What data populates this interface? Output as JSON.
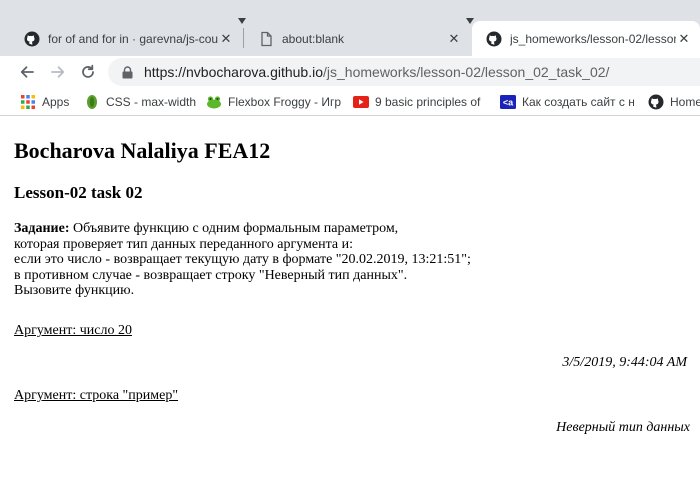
{
  "browser": {
    "tabs": [
      {
        "title": "for of and for in · garevna/js-cou",
        "icon": "github-icon",
        "active": false
      },
      {
        "title": "about:blank",
        "icon": "page-icon",
        "active": false
      },
      {
        "title": "js_homeworks/lesson-02/lesson_",
        "icon": "github-icon",
        "active": true
      }
    ],
    "close_glyph": "✕",
    "url_host": "https://nvbocharova.github.io",
    "url_path": "/js_homeworks/lesson-02/lesson_02_task_02/",
    "bookmarks": [
      {
        "label": "Apps",
        "icon": "apps-grid-icon"
      },
      {
        "label": "CSS - max-width",
        "icon": "android-icon"
      },
      {
        "label": "Flexbox Froggy - Игр",
        "icon": "frog-icon"
      },
      {
        "label": "9 basic principles of",
        "icon": "youtube-icon"
      },
      {
        "label": "Как создать сайт с н",
        "icon": "link-icon"
      },
      {
        "label": "Home",
        "icon": "github-icon"
      }
    ]
  },
  "page": {
    "title": "Bocharova Nalaliya FEA12",
    "subtitle": "Lesson-02 task 02",
    "task_label": "Задание:",
    "task_lines": [
      "Объявите функцию с одним формальным параметром,",
      "которая проверяет тип данных переданного аргумента и:",
      "если это число - возвращает текущую дату в формате \"20.02.2019, 13:21:51\";",
      "в противном случае - возвращает строку \"Неверный тип данных\".",
      "Вызовите функцию."
    ],
    "link_number": "Аргумент: число 20",
    "result_number": "3/5/2019, 9:44:04 AM",
    "link_string": "Аргумент: строка \"пример\"",
    "result_string": "Неверный тип данных"
  },
  "colors": {
    "tabstrip": "#dee1e6",
    "omnibox": "#f1f3f4",
    "url_path": "#5f6368"
  }
}
